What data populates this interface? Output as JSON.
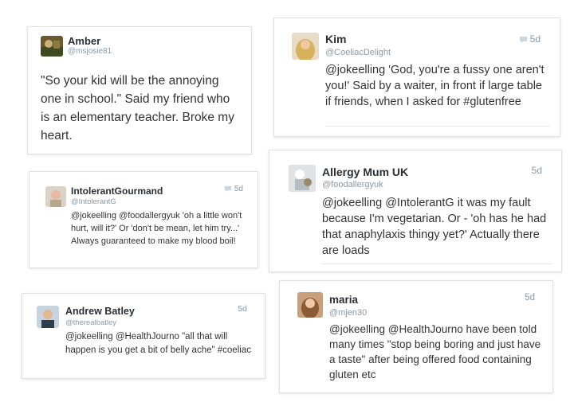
{
  "tweets": [
    {
      "name": "Amber",
      "handle": "@msjosie81",
      "time": "",
      "text": "\"So your kid will be the annoying one in school.\" Said my friend who is an elementary teacher. Broke my heart."
    },
    {
      "name": "Kim",
      "handle": "@CoeliacDelight",
      "time": "5d",
      "text": "@jokeelling 'God, you're a fussy one aren't you!' Said by a waiter, in front if large table if friends, when I asked for #glutenfree"
    },
    {
      "name": "IntolerantGourmand",
      "handle": "@IntolerantG",
      "time": "5d",
      "text": "@jokeelling @foodallergyuk 'oh a little won't hurt, will it?' Or 'don't be mean, let him try...' Always guaranteed to make my blood boil!"
    },
    {
      "name": "Allergy Mum UK",
      "handle": "@foodallergyuk",
      "time": "5d",
      "text": "@jokeelling @IntolerantG it was my fault because I'm vegetarian. Or - 'oh has he had that anaphylaxis thingy yet?' Actually there are loads"
    },
    {
      "name": "Andrew Batley",
      "handle": "@therealbatley",
      "time": "5d",
      "text": "@jokeelling @HealthJourno \"all that will happen is you get a bit of belly ache\" #coeliac"
    },
    {
      "name": "maria",
      "handle": "@mjen30",
      "time": "5d",
      "text": "@jokeelling @HealthJourno have been told many times \"stop being boring and just have a taste\" after being offered food containing gluten etc"
    }
  ],
  "icons": {
    "reply_bubble": "speech-bubble-icon"
  },
  "colors": {
    "name": "#292f33",
    "meta": "#8899a6",
    "text": "#333333"
  }
}
